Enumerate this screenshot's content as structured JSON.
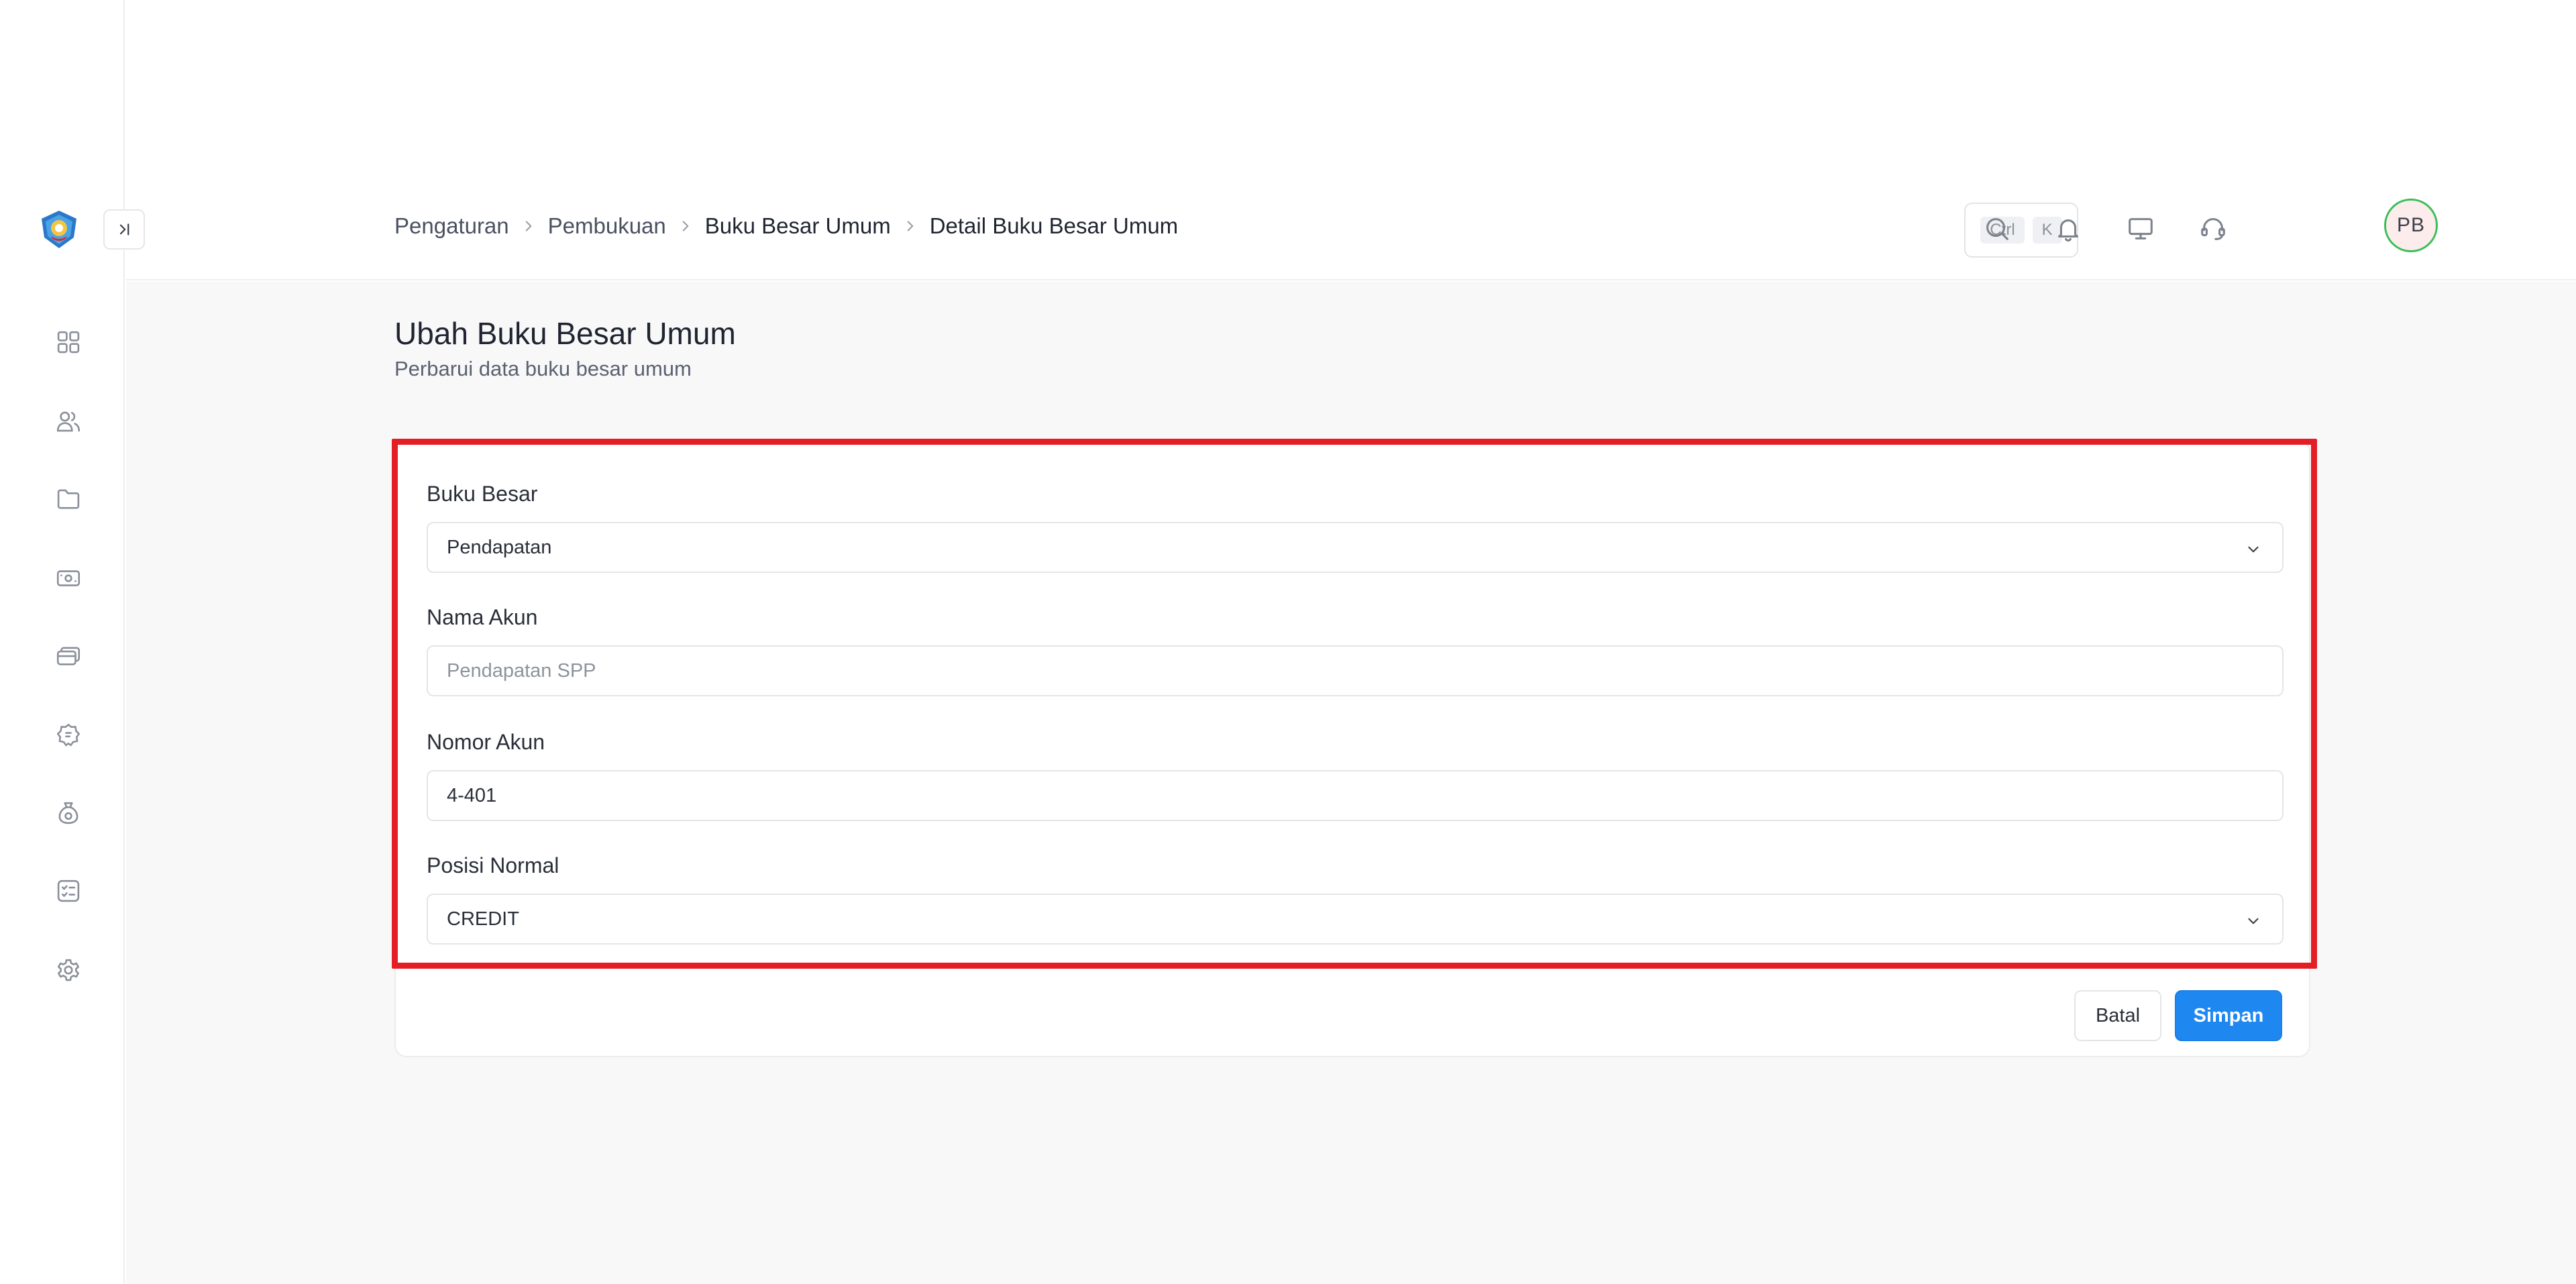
{
  "header": {
    "breadcrumb": [
      "Pengaturan",
      "Pembukuan",
      "Buku Besar Umum",
      "Detail Buku Besar Umum"
    ],
    "shortcut_keys": [
      "Ctrl",
      "K"
    ],
    "avatar_initials": "PB",
    "icons": [
      "search-icon",
      "bell-icon",
      "monitor-icon",
      "headset-icon"
    ]
  },
  "sidebar": {
    "items": [
      {
        "icon": "dashboard-icon"
      },
      {
        "icon": "users-icon"
      },
      {
        "icon": "folder-icon"
      },
      {
        "icon": "cash-icon"
      },
      {
        "icon": "cards-icon"
      },
      {
        "icon": "badge-icon"
      },
      {
        "icon": "coin-bag-icon"
      },
      {
        "icon": "checklist-icon"
      },
      {
        "icon": "gear-icon"
      }
    ]
  },
  "page": {
    "title": "Ubah Buku Besar Umum",
    "subtitle": "Perbarui data buku besar umum"
  },
  "form": {
    "buku_besar": {
      "label": "Buku Besar",
      "value": "Pendapatan"
    },
    "nama_akun": {
      "label": "Nama Akun",
      "placeholder": "Pendapatan SPP"
    },
    "nomor_akun": {
      "label": "Nomor Akun",
      "value": "4-401"
    },
    "posisi_normal": {
      "label": "Posisi Normal",
      "value": "CREDIT"
    },
    "cancel_label": "Batal",
    "save_label": "Simpan"
  },
  "colors": {
    "highlight": "#e41e25",
    "primary": "#1f88f0",
    "avatar_ring": "#3bbf5a"
  }
}
